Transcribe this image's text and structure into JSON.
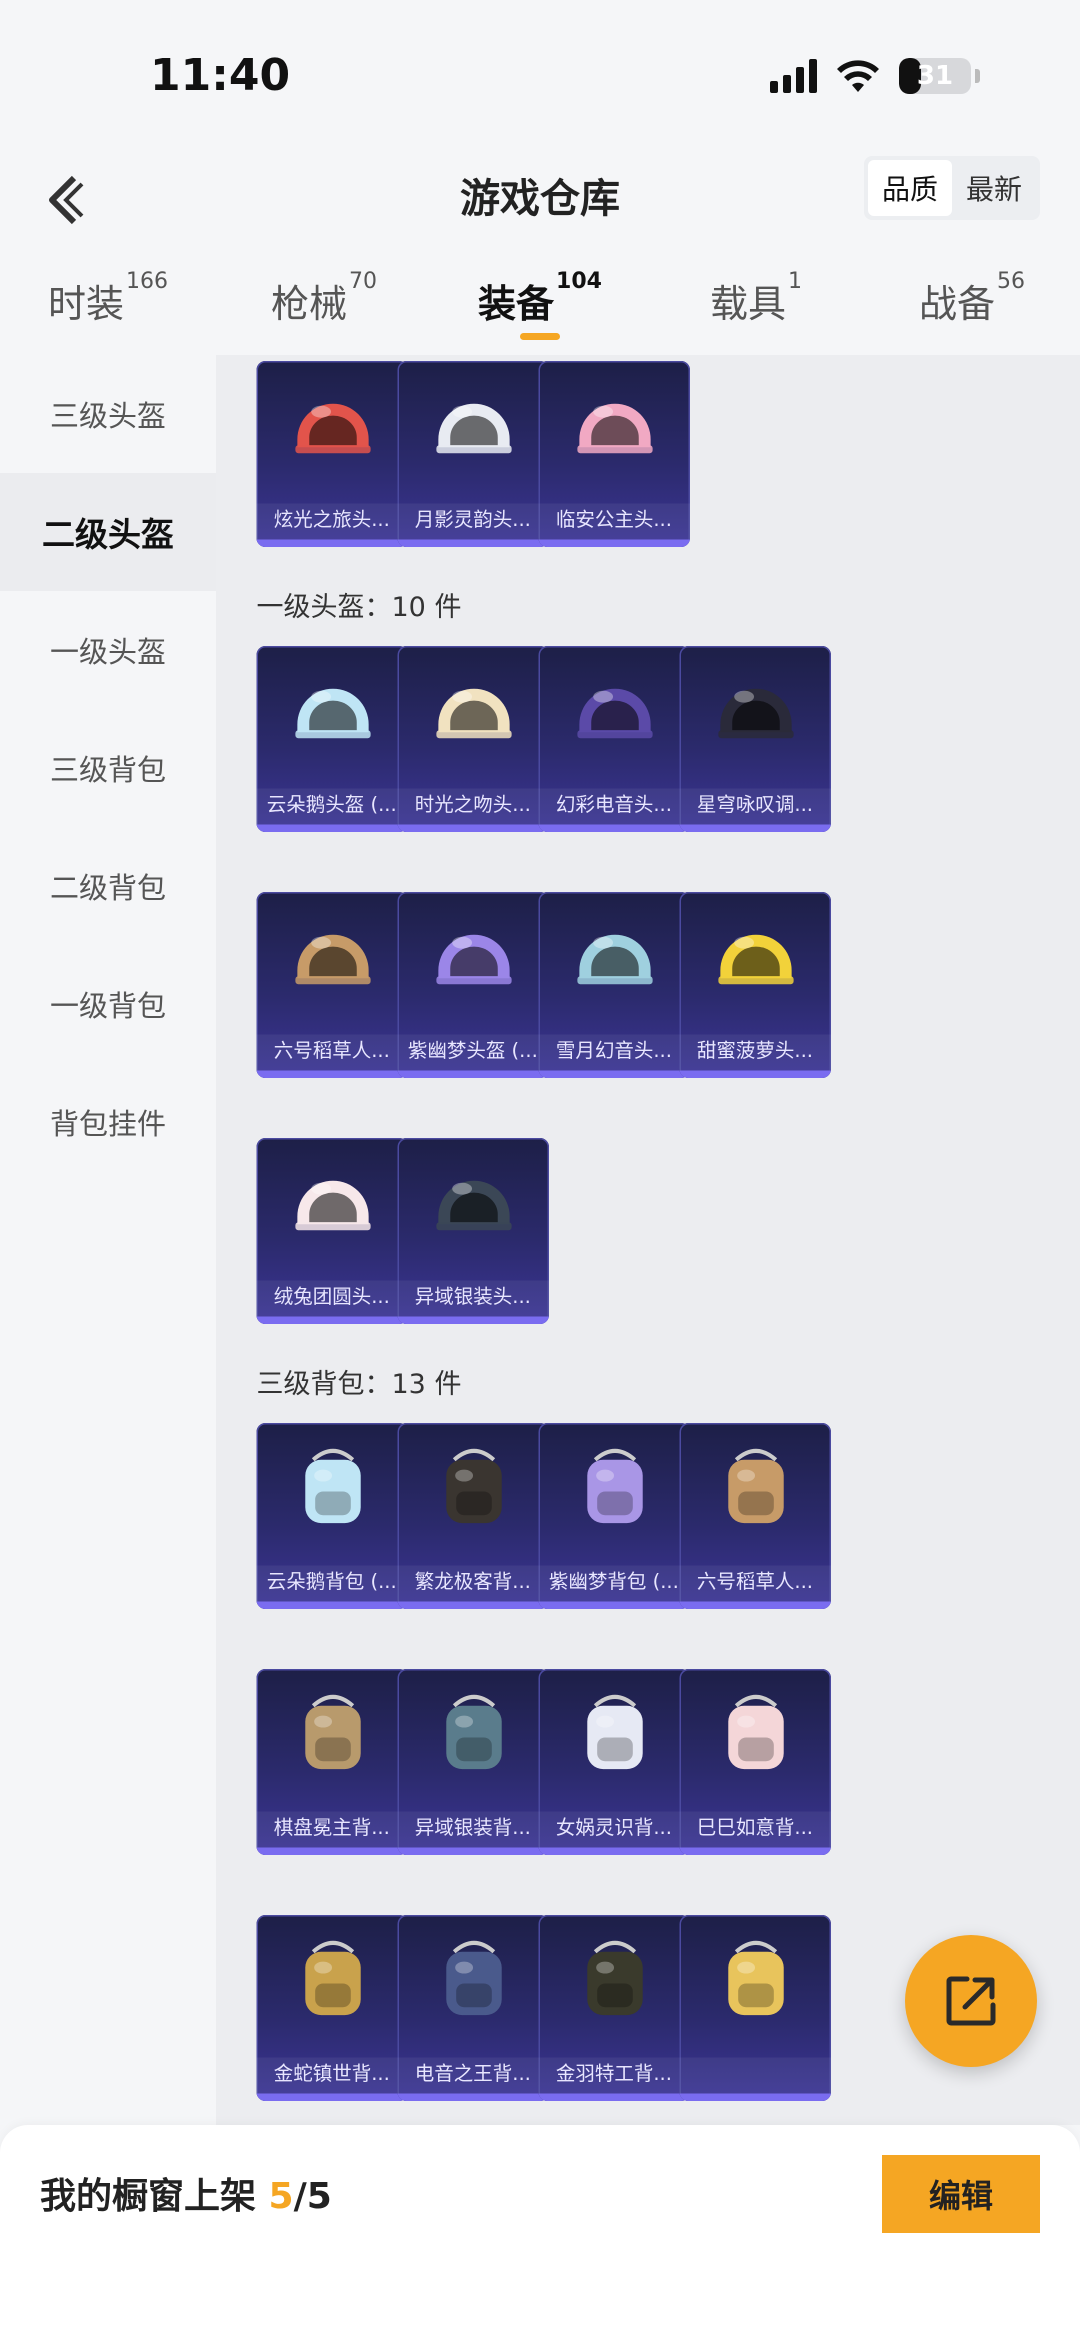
{
  "status": {
    "time": "11:40",
    "battery": "31",
    "battery_level": 0.31
  },
  "header": {
    "title": "游戏仓库",
    "sort_options": [
      "品质",
      "最新"
    ]
  },
  "tabs": [
    {
      "label": "时装",
      "count": "166"
    },
    {
      "label": "枪械",
      "count": "70"
    },
    {
      "label": "装备",
      "count": "104"
    },
    {
      "label": "载具",
      "count": "1"
    },
    {
      "label": "战备",
      "count": "56"
    }
  ],
  "sidebar": {
    "items": [
      {
        "label": "三级头盔"
      },
      {
        "label": "二级头盔"
      },
      {
        "label": "一级头盔"
      },
      {
        "label": "三级背包"
      },
      {
        "label": "二级背包"
      },
      {
        "label": "一级背包"
      },
      {
        "label": "背包挂件"
      }
    ]
  },
  "sections": [
    {
      "title": "",
      "items": [
        {
          "name": "炫光之旅头...",
          "icon": "helmet-icon",
          "color": "#e2544b"
        },
        {
          "name": "月影灵韵头...",
          "icon": "helmet-icon",
          "color": "#e8ebf2"
        },
        {
          "name": "临安公主头...",
          "icon": "helmet-icon",
          "color": "#f1a9c3"
        }
      ]
    },
    {
      "title": "一级头盔：10 件",
      "items": [
        {
          "name": "云朵鹅头盔 (...",
          "icon": "helmet-icon",
          "color": "#bfe5f5"
        },
        {
          "name": "时光之吻头...",
          "icon": "helmet-icon",
          "color": "#f1e2c0"
        },
        {
          "name": "幻彩电音头...",
          "icon": "helmet-icon",
          "color": "#5b4aa8"
        },
        {
          "name": "星穹咏叹调...",
          "icon": "helmet-icon",
          "color": "#2a2a3a"
        },
        {
          "name": "六号稻草人...",
          "icon": "helmet-icon",
          "color": "#c79b68"
        },
        {
          "name": "紫幽梦头盔 (...",
          "icon": "helmet-icon",
          "color": "#9b86e8"
        },
        {
          "name": "雪月幻音头...",
          "icon": "helmet-icon",
          "color": "#9fd0df"
        },
        {
          "name": "甜蜜菠萝头...",
          "icon": "helmet-icon",
          "color": "#f2d23a"
        },
        {
          "name": "绒兔团圆头...",
          "icon": "helmet-icon",
          "color": "#f7e8ea"
        },
        {
          "name": "异域银装头...",
          "icon": "helmet-icon",
          "color": "#3b4756"
        }
      ]
    },
    {
      "title": "三级背包：13 件",
      "items": [
        {
          "name": "云朵鹅背包 (...",
          "icon": "backpack-icon",
          "color": "#bfe5f5"
        },
        {
          "name": "繁龙极客背...",
          "icon": "backpack-icon",
          "color": "#3a3530"
        },
        {
          "name": "紫幽梦背包 (...",
          "icon": "backpack-icon",
          "color": "#a996e6"
        },
        {
          "name": "六号稻草人...",
          "icon": "backpack-icon",
          "color": "#c79b68"
        },
        {
          "name": "棋盘冕主背...",
          "icon": "backpack-icon",
          "color": "#b89a6c"
        },
        {
          "name": "异域银装背...",
          "icon": "backpack-icon",
          "color": "#5a7c8c"
        },
        {
          "name": "女娲灵识背...",
          "icon": "backpack-icon",
          "color": "#e6e9f4"
        },
        {
          "name": "巳巳如意背...",
          "icon": "backpack-icon",
          "color": "#f4d6d8"
        },
        {
          "name": "金蛇镇世背...",
          "icon": "backpack-icon",
          "color": "#c9a24c"
        },
        {
          "name": "电音之王背...",
          "icon": "backpack-icon",
          "color": "#4a5a8c"
        },
        {
          "name": "金羽特工背...",
          "icon": "backpack-icon",
          "color": "#3a3a2c"
        },
        {
          "name": "",
          "icon": "backpack-icon",
          "color": "#e8c45c"
        },
        {
          "name": "",
          "icon": "backpack-icon",
          "color": "#2a2a5a"
        }
      ]
    }
  ],
  "share_button": {
    "icon": "share-external-icon"
  },
  "bottom_bar": {
    "label_prefix": "我的橱窗上架 ",
    "count_used": "5",
    "count_sep": "/",
    "count_total": "5",
    "edit_label": "编辑"
  },
  "colors": {
    "accent": "#f5a623",
    "card_bg": "#2b2a6c"
  }
}
